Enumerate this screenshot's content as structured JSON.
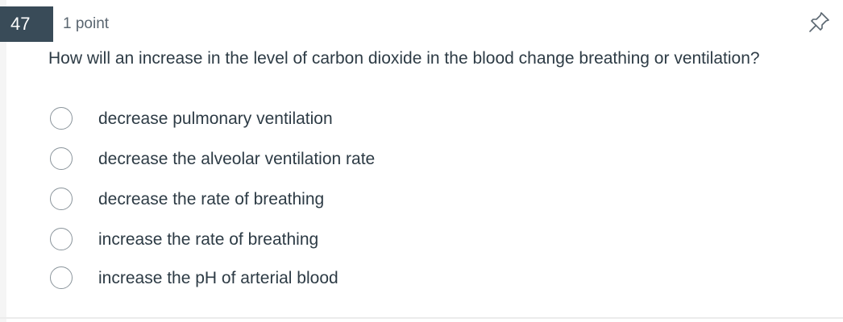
{
  "question": {
    "number": "47",
    "points": "1 point",
    "text": "How will an increase in the level of carbon dioxide in the blood change breathing or ventilation?",
    "pin_icon": "pin-icon"
  },
  "options": [
    {
      "label": "decrease pulmonary ventilation",
      "selected": false
    },
    {
      "label": "decrease the alveolar ventilation rate",
      "selected": false
    },
    {
      "label": "decrease the rate of breathing",
      "selected": false
    },
    {
      "label": "increase the rate of breathing",
      "selected": false
    },
    {
      "label": "increase the pH of arterial blood",
      "selected": false
    }
  ],
  "colors": {
    "number_badge_bg": "#394b58",
    "text": "#2d3b45",
    "radio_border": "#8b959c"
  }
}
